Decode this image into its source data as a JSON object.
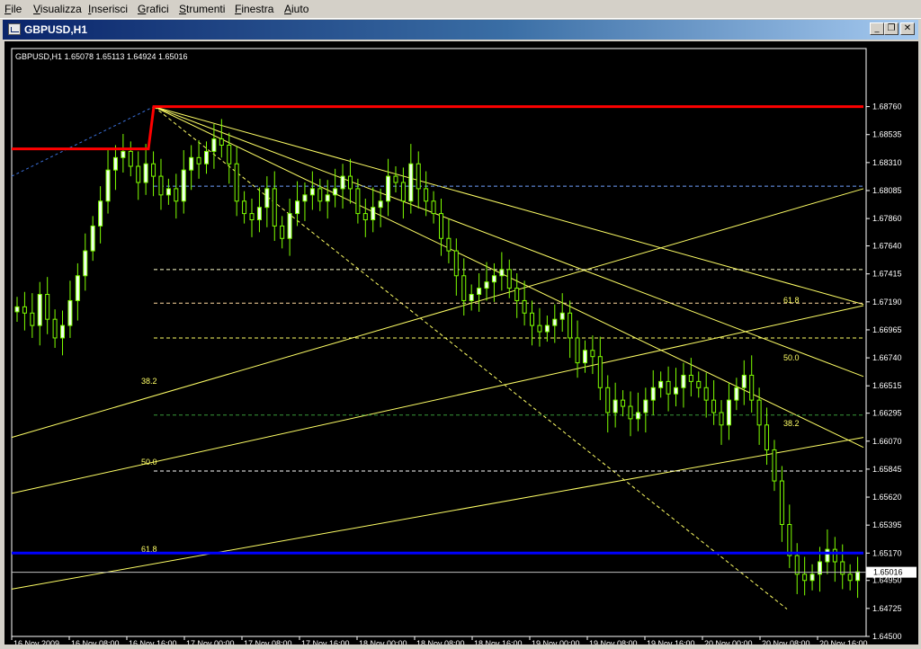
{
  "menu": [
    {
      "label": "File",
      "accel": "F",
      "rest": "ile"
    },
    {
      "label": "Visualizza",
      "accel": "V",
      "rest": "isualizza"
    },
    {
      "label": "Inserisci",
      "accel": "I",
      "rest": "nserisci"
    },
    {
      "label": "Grafici",
      "accel": "G",
      "rest": "rafici"
    },
    {
      "label": "Strumenti",
      "accel": "S",
      "rest": "trumenti"
    },
    {
      "label": "Finestra",
      "accel": "F",
      "rest": "inestra"
    },
    {
      "label": "Aiuto",
      "accel": "A",
      "rest": "iuto"
    }
  ],
  "window": {
    "title": "GBPUSD,H1",
    "minimize_glyph": "_",
    "restore_glyph": "❐",
    "close_glyph": "✕"
  },
  "chart": {
    "info_line": "GBPUSD,H1  1.65078 1.65113 1.64924 1.65016",
    "current_price_label": "1.65016",
    "colors": {
      "background": "#000000",
      "bull_candle": "#f0fff0",
      "wick": "#7fff00",
      "high_line": "#ff0000",
      "support_line": "#0000ff",
      "fib_lines": "#ffff66",
      "grid_text": "#ffffff"
    }
  },
  "chart_data": {
    "type": "candlestick",
    "symbol": "GBPUSD",
    "timeframe": "H1",
    "last_price": 1.65016,
    "y_ticks": [
      "1.68760",
      "1.68535",
      "1.68310",
      "1.68085",
      "1.67860",
      "1.67640",
      "1.67415",
      "1.67190",
      "1.66965",
      "1.66740",
      "1.66515",
      "1.66295",
      "1.66070",
      "1.65845",
      "1.65620",
      "1.65395",
      "1.65170",
      "1.64950",
      "1.64725",
      "1.64500"
    ],
    "x_ticks": [
      "16 Nov 2009",
      "16 Nov 08:00",
      "16 Nov 16:00",
      "17 Nov 00:00",
      "17 Nov 08:00",
      "17 Nov 16:00",
      "18 Nov 00:00",
      "18 Nov 08:00",
      "18 Nov 16:00",
      "19 Nov 00:00",
      "19 Nov 08:00",
      "19 Nov 16:00",
      "20 Nov 00:00",
      "20 Nov 08:00",
      "20 Nov 16:00"
    ],
    "ylim": [
      1.645,
      1.6888
    ],
    "fib_labels": [
      "61.8",
      "50.0",
      "38.2",
      "38.2",
      "50.0",
      "61.8"
    ],
    "horizontal_levels": {
      "resistance": 1.6876,
      "support": 1.6517
    },
    "close_path": [
      1.6715,
      1.671,
      1.67,
      1.6725,
      1.6705,
      1.669,
      1.67,
      1.672,
      1.674,
      1.676,
      1.678,
      1.68,
      1.6825,
      1.6835,
      1.684,
      1.6828,
      1.6815,
      1.683,
      1.682,
      1.6805,
      1.681,
      1.68,
      1.6825,
      1.6835,
      1.683,
      1.684,
      1.685,
      1.6845,
      1.683,
      1.68,
      1.679,
      1.6785,
      1.6795,
      1.681,
      1.678,
      1.677,
      1.679,
      1.68,
      1.6805,
      1.681,
      1.68,
      1.6805,
      1.681,
      1.682,
      1.681,
      1.679,
      1.6785,
      1.6795,
      1.68,
      1.682,
      1.6815,
      1.68,
      1.683,
      1.681,
      1.68,
      1.679,
      1.677,
      1.676,
      1.674,
      1.672,
      1.6725,
      1.673,
      1.6735,
      1.674,
      1.6745,
      1.673,
      1.672,
      1.671,
      1.67,
      1.6695,
      1.67,
      1.6705,
      1.671,
      1.669,
      1.667,
      1.668,
      1.6675,
      1.665,
      1.663,
      1.664,
      1.6635,
      1.6625,
      1.663,
      1.664,
      1.665,
      1.6655,
      1.6645,
      1.665,
      1.666,
      1.6655,
      1.665,
      1.664,
      1.663,
      1.662,
      1.664,
      1.665,
      1.666,
      1.664,
      1.662,
      1.66,
      1.6575,
      1.654,
      1.6515,
      1.65,
      1.6495,
      1.65,
      1.651,
      1.652,
      1.651,
      1.65,
      1.6495,
      1.6502
    ]
  }
}
